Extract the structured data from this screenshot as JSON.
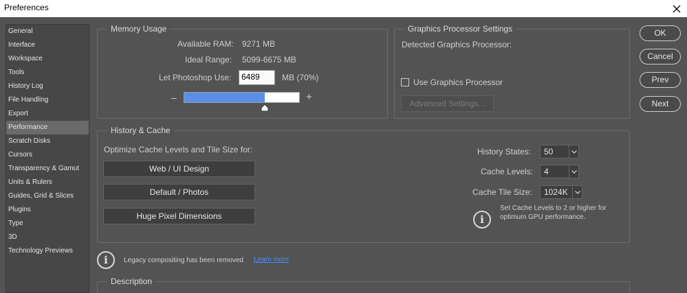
{
  "window": {
    "title": "Preferences"
  },
  "sidebar": {
    "items": [
      {
        "label": "General"
      },
      {
        "label": "Interface"
      },
      {
        "label": "Workspace"
      },
      {
        "label": "Tools"
      },
      {
        "label": "History Log"
      },
      {
        "label": "File Handling"
      },
      {
        "label": "Export"
      },
      {
        "label": "Performance",
        "active": true
      },
      {
        "label": "Scratch Disks"
      },
      {
        "label": "Cursors"
      },
      {
        "label": "Transparency & Gamut"
      },
      {
        "label": "Units & Rulers"
      },
      {
        "label": "Guides, Grid & Slices"
      },
      {
        "label": "Plugins"
      },
      {
        "label": "Type"
      },
      {
        "label": "3D"
      },
      {
        "label": "Technology Previews"
      }
    ]
  },
  "memory": {
    "title": "Memory Usage",
    "available_label": "Available RAM:",
    "available_value": "9271 MB",
    "ideal_label": "Ideal Range:",
    "ideal_value": "5099-6675 MB",
    "let_label": "Let Photoshop Use:",
    "let_value": "6489",
    "let_suffix": "MB (70%)",
    "slider_fraction": 0.7,
    "minus": "–",
    "plus": "+"
  },
  "gpu": {
    "title": "Graphics Processor Settings",
    "detected_label": "Detected Graphics Processor:",
    "use_label": "Use Graphics Processor",
    "advanced_label": "Advanced Settings..."
  },
  "history_cache": {
    "title": "History & Cache",
    "optimize_label": "Optimize Cache Levels and Tile Size for:",
    "btn_web": "Web / UI Design",
    "btn_default": "Default / Photos",
    "btn_huge": "Huge Pixel Dimensions",
    "history_states_label": "History States:",
    "history_states_value": "50",
    "cache_levels_label": "Cache Levels:",
    "cache_levels_value": "4",
    "tile_size_label": "Cache Tile Size:",
    "tile_size_value": "1024K",
    "info_line1": "Set Cache Levels to 2 or higher for",
    "info_line2": "optimum GPU performance."
  },
  "legacy": {
    "text": "Legacy compositing has been removed",
    "link": "Learn more"
  },
  "description": {
    "title": "Description"
  },
  "actions": {
    "ok": "OK",
    "cancel": "Cancel",
    "prev": "Prev",
    "next": "Next"
  },
  "colors": {
    "accent": "#5b8ee6",
    "background": "#535353",
    "link": "#4c8bf5"
  }
}
